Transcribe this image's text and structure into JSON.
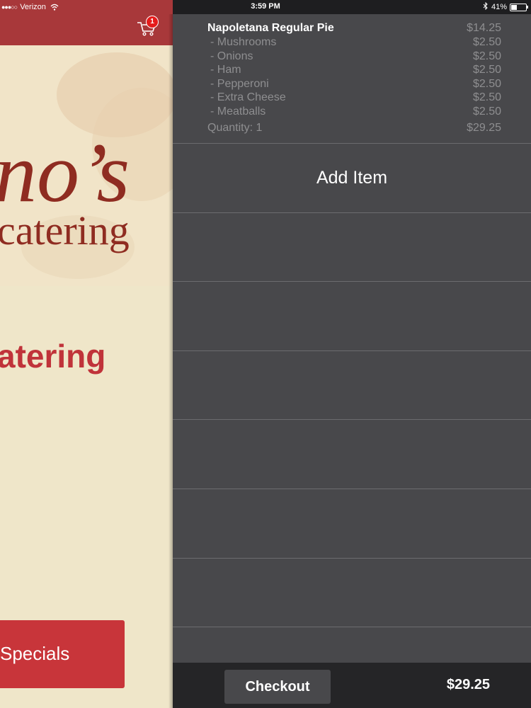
{
  "status_bar": {
    "signal": "●●●○○",
    "carrier": "Verizon",
    "time": "3:59 PM",
    "battery": "41%"
  },
  "app": {
    "cart_badge": "1",
    "logo_big": "no’s",
    "logo_sub": "catering",
    "catering_heading": "atering",
    "specials_label": "Specials"
  },
  "order": {
    "item_name": "Napoletana Regular Pie",
    "item_price": "$14.25",
    "modifiers": [
      {
        "name": "- Mushrooms",
        "price": "$2.50"
      },
      {
        "name": "- Onions",
        "price": "$2.50"
      },
      {
        "name": "- Ham",
        "price": "$2.50"
      },
      {
        "name": "- Pepperoni",
        "price": "$2.50"
      },
      {
        "name": "- Extra Cheese",
        "price": "$2.50"
      },
      {
        "name": "- Meatballs",
        "price": "$2.50"
      }
    ],
    "quantity_label": "Quantity: 1",
    "line_total": "$29.25"
  },
  "cart": {
    "add_item_label": "Add Item"
  },
  "footer": {
    "checkout_label": "Checkout",
    "total": "$29.25"
  },
  "colors": {
    "brand_red": "#a8383a",
    "panel_bg": "#48484b",
    "badge_red": "#e51b1b"
  }
}
